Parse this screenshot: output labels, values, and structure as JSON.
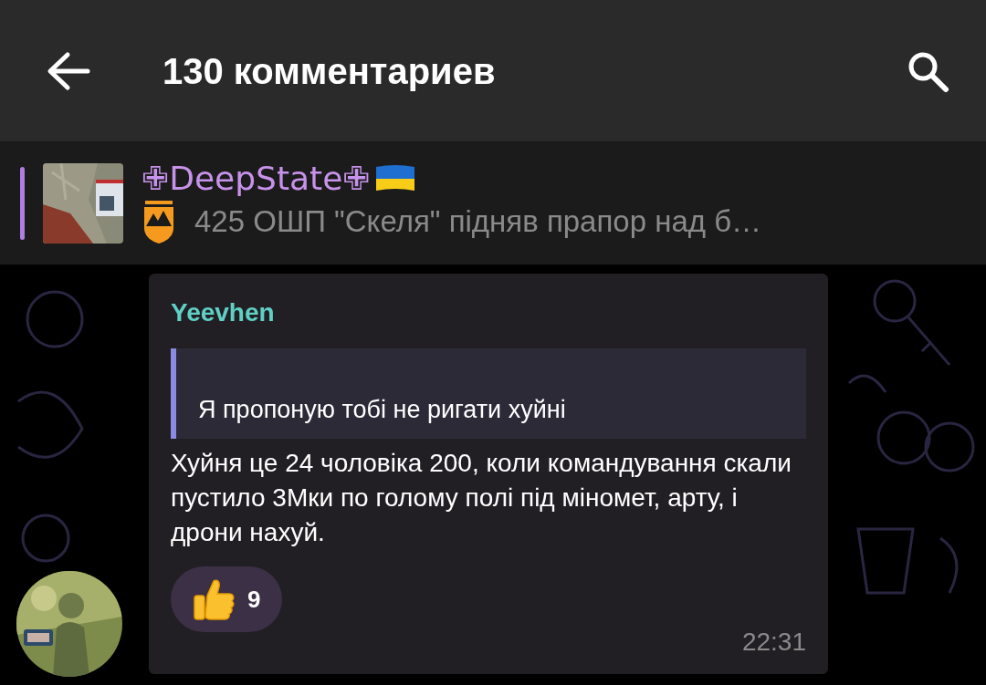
{
  "header": {
    "title": "130 комментариев"
  },
  "pinned": {
    "channel": "✙DeepState✙",
    "preview": "425 ОШП \"Скеля\" підняв прапор над б…"
  },
  "message": {
    "author": "Yeevhen",
    "reply_quote": "Я пропоную тобі не ригати хуйні",
    "text": "Хуйня це 24 чоловіка 200, коли командування скали пустило 3Мки по голому полі під міномет, арту, і дрони нахуй.",
    "reactions": [
      {
        "kind": "thumbs_up",
        "count": "9",
        "selected": false
      }
    ],
    "time": "22:31"
  }
}
